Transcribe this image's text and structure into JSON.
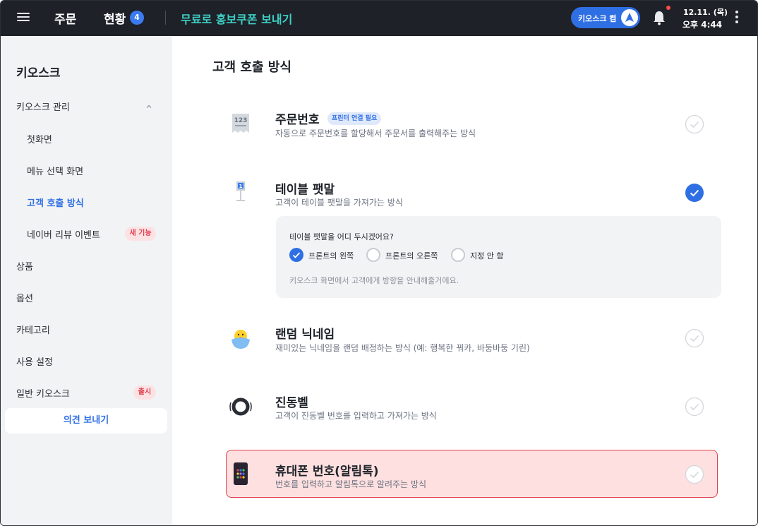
{
  "topbar": {
    "nav_order": "주문",
    "nav_status": "현황",
    "status_count": "4",
    "promo_title": "무료로 홍보쿠폰 보내기",
    "kiosk_pill": "키오스크 켬",
    "date": "12.11. (목)",
    "time": "오후 4:44"
  },
  "sidebar": {
    "title": "키오스크",
    "kiosk_manage": "키오스크 관리",
    "sub_items": [
      "첫화면",
      "메뉴 선택 화면",
      "고객 호출 방식",
      "네이버 리뷰 이벤트"
    ],
    "new_feature_badge": "새 기능",
    "items": [
      "상품",
      "옵션",
      "카테고리",
      "사용 설정",
      "일반 키오스크"
    ],
    "launch_badge": "출시",
    "feedback_button": "의견 보내기"
  },
  "main": {
    "section_title": "고객 호출 방식",
    "options": [
      {
        "title": "주문번호",
        "desc": "자동으로 주문번호를 할당해서 주문서를 출력해주는 방식",
        "selected": false,
        "icon": "receipt-123-icon",
        "icon_text": "123"
      },
      {
        "title": "테이블 팻말",
        "desc": "고객이 테이블 팻말을 가져가는 방식",
        "selected": true,
        "icon": "table-sign-icon",
        "icon_text": "1"
      },
      {
        "title": "랜덤 닉네임",
        "desc": "재미있는 닉네임을 랜덤 배정하는 방식 (예: 행복한 꿔카, 바둥바둥 기린)",
        "selected": false,
        "icon": "chick-icon"
      },
      {
        "title": "진동벨",
        "desc": "고객이 진동벨 번호를 입력하고 가져가는 방식",
        "selected": false,
        "icon": "vibration-bell-icon"
      },
      {
        "title": "휴대폰 번호(알림톡)",
        "desc": "번호를 입력하고 알림톡으로 알려주는 방식",
        "selected": false,
        "icon": "phone-icon"
      }
    ],
    "printer_badge": "프린터 연결 필요",
    "table_sign_panel": {
      "question": "테이블 팻말을 어디 두시겠어요?",
      "choices": [
        "프론트의 왼쪽",
        "프론트의 오른쪽",
        "지정 안 함"
      ],
      "selected": "프론트의 왼쪽",
      "note": "키오스크 화면에서 고객에게 방향을 안내해줄거에요."
    }
  },
  "colors": {
    "accent": "#2f6fe4",
    "topbar_bg": "#1e2128",
    "promo_text": "#3ecfc3",
    "badge_red": "#e0414f",
    "highlight_bg": "#fee0e0"
  }
}
